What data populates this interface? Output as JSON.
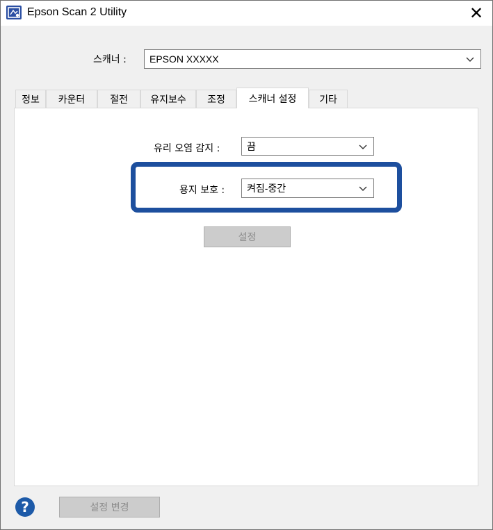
{
  "window": {
    "title": "Epson Scan 2 Utility"
  },
  "scanner": {
    "label": "스캐너 :",
    "value": "EPSON XXXXX"
  },
  "tabs": [
    {
      "label": "정보"
    },
    {
      "label": "카운터"
    },
    {
      "label": "절전"
    },
    {
      "label": "유지보수"
    },
    {
      "label": "조정"
    },
    {
      "label": "스캐너 설정"
    },
    {
      "label": "기타"
    }
  ],
  "settings": {
    "glass_dirt": {
      "label": "유리 오염 감지 :",
      "value": "끔"
    },
    "paper_protection": {
      "label": "용지 보호 :",
      "value": "켜짐-중간"
    },
    "set_button": "설정"
  },
  "footer": {
    "change_settings_button": "설정 변경"
  },
  "colors": {
    "highlight": "#1d4f9e",
    "help_icon": "#1d5aa8"
  }
}
